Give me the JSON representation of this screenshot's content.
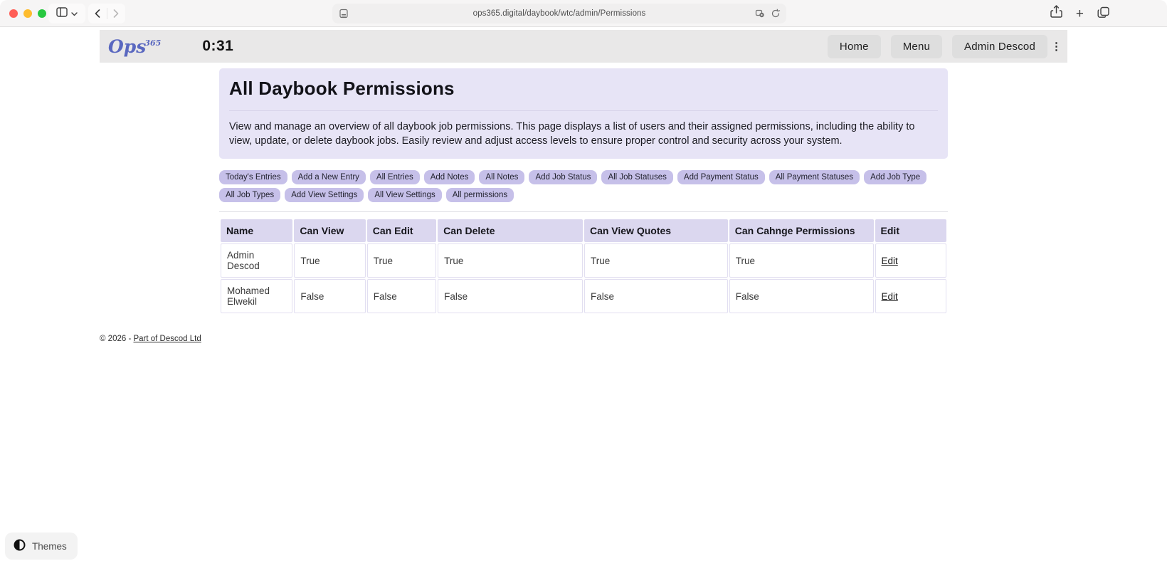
{
  "browser": {
    "url": "ops365.digital/daybook/wtc/admin/Permissions",
    "plus_glyph": "+"
  },
  "header": {
    "logo_text": "Ops",
    "logo_sup": "365",
    "timer": "0:31",
    "nav": [
      {
        "label": "Home"
      },
      {
        "label": "Menu"
      },
      {
        "label": "Admin Descod"
      }
    ],
    "overflow_glyph": "⋮"
  },
  "jumbotron": {
    "title": "All Daybook Permissions",
    "description": "View and manage an overview of all daybook job permissions. This page displays a list of users and their assigned permissions, including the ability to view, update, or delete daybook jobs. Easily review and adjust access levels to ensure proper control and security across your system."
  },
  "action_pills": [
    "Today's Entries",
    "Add a New Entry",
    "All Entries",
    "Add Notes",
    "All Notes",
    "Add Job Status",
    "All Job Statuses",
    "Add Payment Status",
    "All Payment Statuses",
    "Add Job Type",
    "All Job Types",
    "Add View Settings",
    "All View Settings",
    "All permissions"
  ],
  "table": {
    "headers": [
      "Name",
      "Can View",
      "Can Edit",
      "Can Delete",
      "Can View Quotes",
      "Can Cahnge Permissions",
      "Edit"
    ],
    "rows": [
      {
        "cells": [
          "Admin Descod",
          "True",
          "True",
          "True",
          "True",
          "True"
        ],
        "edit_label": "Edit"
      },
      {
        "cells": [
          "Mohamed Elwekil",
          "False",
          "False",
          "False",
          "False",
          "False"
        ],
        "edit_label": "Edit"
      }
    ]
  },
  "footer": {
    "copyright_prefix": "© 2026 - ",
    "link_label": "Part of Descod Ltd"
  },
  "themes_button": {
    "label": "Themes"
  },
  "colors": {
    "accent_pill": "#c6c0e9",
    "jumbotron_bg": "#e7e4f6",
    "table_header_bg": "#dbd7ef",
    "site_header_bg": "#e9e8e8",
    "logo_blue": "#5a68c0",
    "traffic_red": "#ff5f57",
    "traffic_yellow": "#febc2e",
    "traffic_green": "#28c840"
  }
}
